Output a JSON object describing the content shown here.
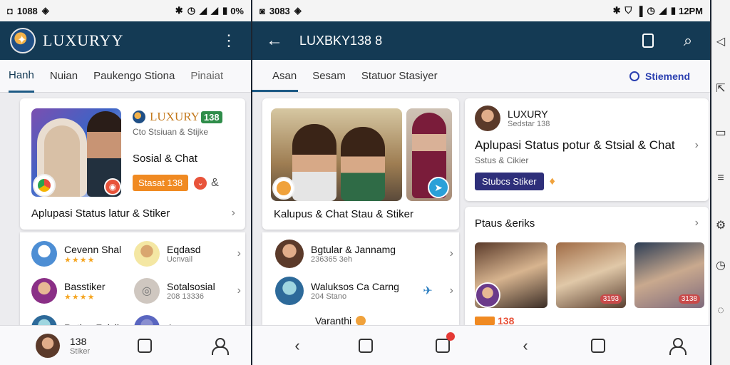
{
  "left": {
    "status": {
      "left": "1088",
      "right": "0%"
    },
    "appbar": {
      "title": "LUXURYY"
    },
    "tabs": [
      "Hanh",
      "Nuian",
      "Paukengo Stiona",
      "Pinaiat"
    ],
    "feature": {
      "brand": "LUXURY",
      "brand_tag": "138",
      "subtitle": "Cto Stsiuan & Stijke",
      "heading": "Sosial & Chat",
      "button": "Stasat 138",
      "caption": "Aplupasi Status latur & Stiker"
    },
    "list": [
      {
        "title": "Cevenn Shal",
        "stars": "★★★★"
      },
      {
        "title": "Eqdasd",
        "sub": "Ucnvail"
      },
      {
        "title": "Basstiker",
        "stars": "★★★★"
      },
      {
        "title": "Sotalsosial",
        "sub": "208 13336"
      },
      {
        "title": "Rotian Faisil",
        "sub": ""
      },
      {
        "title": "A",
        "sub": ""
      }
    ],
    "bottom": {
      "title": "138",
      "sub": "Stiker"
    }
  },
  "right": {
    "status": {
      "left": "3083",
      "right": "12PM"
    },
    "appbar": {
      "title": "LUXBKY138 8"
    },
    "tabs": [
      "Asan",
      "Sesam",
      "Statuor Stasiyer"
    ],
    "stream": "Stiemend",
    "feature": {
      "caption": "Kalupus & Chat Stau & Stiker"
    },
    "list": [
      {
        "title": "Bgtular & Jannamg",
        "sub": "236365 3eh"
      },
      {
        "title": "Waluksos Ca Carng",
        "sub": "204 Stano"
      },
      {
        "title": "Varanthi",
        "sub": ""
      }
    ],
    "app_card": {
      "brand": "LUXURY",
      "brand_sub": "Sedstar 138",
      "heading": "Aplupasi Status potur & Stsial & Chat",
      "sub": "Sstus & Cikier",
      "button": "Stubcs Stiker"
    },
    "photos": {
      "heading": "Ptaus &eriks",
      "tags": [
        "3193",
        "3138"
      ],
      "price_tag": "138"
    }
  }
}
